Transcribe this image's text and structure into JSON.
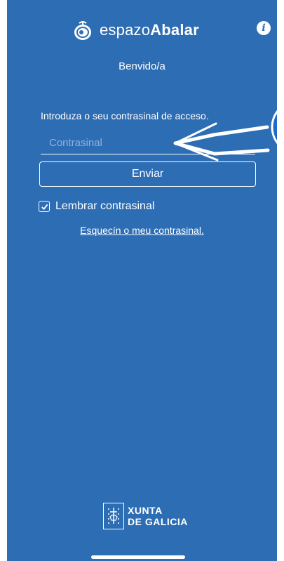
{
  "app": {
    "logo_light": "espazo",
    "logo_bold": "Abalar",
    "logo_icon": "espazo-abalar-logo-icon",
    "info_icon": "info-icon"
  },
  "login": {
    "welcome": "Benvido/a",
    "instructions": "Introduza o seu contrasinal de acceso.",
    "password_placeholder": "Contrasinal",
    "password_value": "",
    "submit_label": "Enviar",
    "remember_label": "Lembrar contrasinal",
    "remember_checked": true,
    "forgot_label": "Esquecín o meu contrasinal."
  },
  "footer": {
    "line1": "XUNTA",
    "line2": "DE GALICIA",
    "icon": "galicia-coat-of-arms-icon"
  },
  "colors": {
    "background": "#2d6db4",
    "foreground": "#ffffff",
    "placeholder": "#8fb1dc"
  }
}
